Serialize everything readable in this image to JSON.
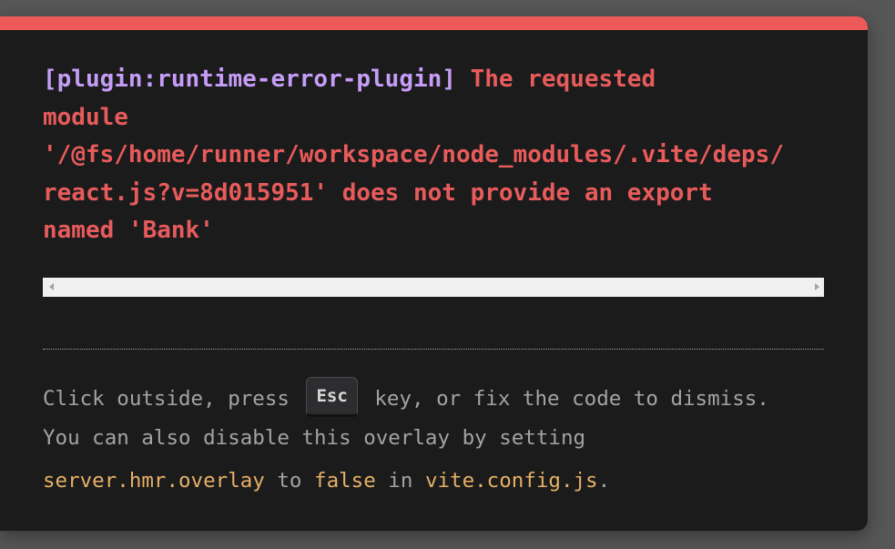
{
  "error": {
    "plugin": "[plugin:runtime-error-plugin]",
    "line_1": " The requested",
    "line_2": "module",
    "line_3": "'/@fs/home/runner/workspace/node_modules/.vite/deps/",
    "line_4": "react.js?v=8d015951' does not provide an export",
    "line_5": "named 'Bank'"
  },
  "tip": {
    "line_1_prefix": "Click outside, press ",
    "esc_key": "Esc",
    "line_1_suffix": " key, or fix the code to dismiss.",
    "line_2": "You can also disable this overlay by setting",
    "setting_code": "server.hmr.overlay",
    "to_word": " to ",
    "false_code": "false",
    "in_word": " in ",
    "config_file": "vite.config.js",
    "period": "."
  },
  "colors": {
    "accent_bar": "#ee5959",
    "plugin_text": "#c69df7",
    "error_text": "#e85b5b",
    "code_text": "#e6b066",
    "tip_text": "#a3a3a3"
  }
}
